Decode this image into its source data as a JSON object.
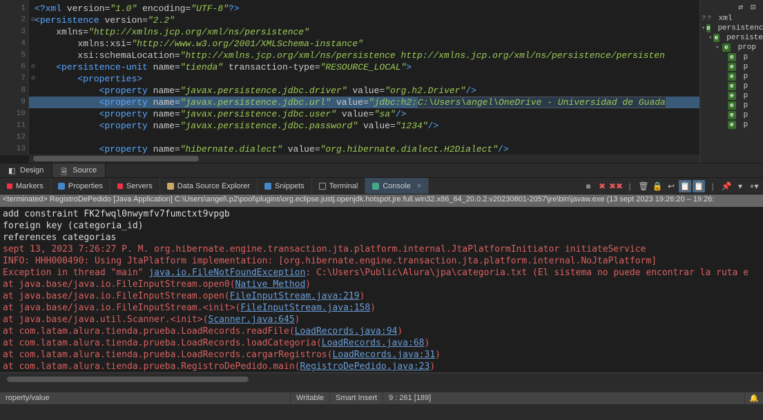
{
  "editor": {
    "lines": {
      "l1": {
        "num": "1",
        "pi_open": "<?",
        "pi_name": "xml",
        "attr1": "version",
        "val1": "\"1.0\"",
        "attr2": "encoding",
        "val2": "\"UTF-8\"",
        "pi_close": "?>"
      },
      "l2": {
        "num": "2",
        "open": "<",
        "tag": "persistence",
        "attr": "version",
        "val": "\"2.2\""
      },
      "l3": {
        "num": "3",
        "attr": "xmlns",
        "val": "\"http://xmlns.jcp.org/xml/ns/persistence\""
      },
      "l4": {
        "num": "4",
        "attr": "xmlns:xsi",
        "val": "\"http://www.w3.org/2001/XMLSchema-instance\""
      },
      "l5": {
        "num": "5",
        "attr": "xsi:schemaLocation",
        "val": "\"http://xmlns.jcp.org/xml/ns/persistence http://xmlns.jcp.org/xml/ns/persistence/persisten"
      },
      "l6": {
        "num": "6",
        "open": "<",
        "tag": "persistence-unit",
        "attr1": "name",
        "val1": "\"tienda\"",
        "attr2": "transaction-type",
        "val2": "\"RESOURCE_LOCAL\"",
        "close": ">"
      },
      "l7": {
        "num": "7",
        "open": "<",
        "tag": "properties",
        "close": ">"
      },
      "l8": {
        "num": "8",
        "open": "<",
        "tag": "property",
        "attr1": "name",
        "val1": "\"javax.persistence.jdbc.driver\"",
        "attr2": "value",
        "val2": "\"org.h2.Driver\"",
        "close": "/>"
      },
      "l9": {
        "num": "9",
        "open": "<",
        "tag": "property",
        "attr1": "name",
        "val1": "\"javax.persistence.jdbc.url\"",
        "attr2": "value",
        "val2a": "\"jdbc:h2:",
        "val2b": "C:\\Users\\angel\\OneDrive - Universidad de Guada"
      },
      "l10": {
        "num": "10",
        "open": "<",
        "tag": "property",
        "attr1": "name",
        "val1": "\"javax.persistence.jdbc.user\"",
        "attr2": "value",
        "val2": "\"sa\"",
        "close": "/>"
      },
      "l11": {
        "num": "11",
        "open": "<",
        "tag": "property",
        "attr1": "name",
        "val1": "\"javax.persistence.jdbc.password\"",
        "attr2": "value",
        "val2": "\"1234\"",
        "close": "/>"
      },
      "l12": {
        "num": "12"
      },
      "l13": {
        "num": "13",
        "open": "<",
        "tag": "property",
        "attr1": "name",
        "val1": "\"hibernate.dialect\"",
        "attr2": "value",
        "val2": "\"org.hibernate.dialect.H2Dialect\"",
        "close": "/>"
      }
    }
  },
  "editor_tabs": {
    "design": "Design",
    "source": "Source"
  },
  "outline": {
    "root": "xml",
    "n1": "persistenc",
    "n2": "persiste",
    "n3": "prop",
    "leaf": "p"
  },
  "bottom_tabs": {
    "markers": "Markers",
    "properties": "Properties",
    "servers": "Servers",
    "data_source": "Data Source Explorer",
    "snippets": "Snippets",
    "terminal": "Terminal",
    "console": "Console"
  },
  "console": {
    "header": "<terminated> RegistroDePedido [Java Application] C:\\Users\\angel\\.p2\\pool\\plugins\\org.eclipse.justj.openjdk.hotspot.jre.full.win32.x86_64_20.0.2.v20230801-2057\\jre\\bin\\javaw.exe  (13 sept 2023 19:26:20 – 19:26:",
    "w1": "    add constraint FK2fwql0nwymfv7fumctxt9vpgb",
    "w2": "    foreign key (categoria_id)",
    "w3": "    references categorias",
    "r1": "sept 13, 2023 7:26:27 P. M. org.hibernate.engine.transaction.jta.platform.internal.JtaPlatformInitiator initiateService",
    "r2": "INFO: HHH000490: Using JtaPlatform implementation: [org.hibernate.engine.transaction.jta.platform.internal.NoJtaPlatform]",
    "r3a": "Exception in thread \"main\" ",
    "r3link": "java.io.FileNotFoundException",
    "r3b": ": C:\\Users\\Public\\Alura\\jpa\\categoria.txt (El sistema no puede encontrar la ruta e",
    "r4a": "    at java.base/java.io.FileInputStream.open0(",
    "r4link": "Native Method",
    "r4b": ")",
    "r5a": "    at java.base/java.io.FileInputStream.open(",
    "r5link": "FileInputStream.java:219",
    "r5b": ")",
    "r6a": "    at java.base/java.io.FileInputStream.<init>(",
    "r6link": "FileInputStream.java:158",
    "r6b": ")",
    "r7a": "    at java.base/java.util.Scanner.<init>(",
    "r7link": "Scanner.java:645",
    "r7b": ")",
    "r8a": "    at com.latam.alura.tienda.prueba.LoadRecords.readFile(",
    "r8link": "LoadRecords.java:94",
    "r8b": ")",
    "r9a": "    at com.latam.alura.tienda.prueba.LoadRecords.loadCategoria(",
    "r9link": "LoadRecords.java:68",
    "r9b": ")",
    "r10a": "    at com.latam.alura.tienda.prueba.LoadRecords.cargarRegistros(",
    "r10link": "LoadRecords.java:31",
    "r10b": ")",
    "r11a": "    at com.latam.alura.tienda.prueba.RegistroDePedido.main(",
    "r11link": "RegistroDePedido.java:23",
    "r11b": ")"
  },
  "status": {
    "s1": "roperty/value",
    "s2": "Writable",
    "s3": "Smart Insert",
    "s4": "9 : 261 [189]"
  }
}
